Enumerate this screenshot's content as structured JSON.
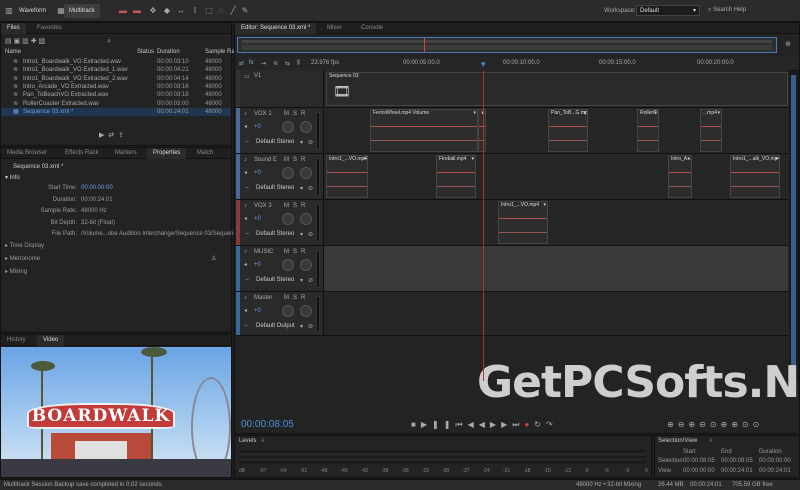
{
  "toolbar": {
    "waveform": "Waveform",
    "multitrack": "Multitrack",
    "workspace_label": "Workspace:",
    "workspace_value": "Default",
    "search_help": "Search Help"
  },
  "files": {
    "tabs": [
      "Files",
      "Favorites"
    ],
    "columns": [
      "Name",
      "Status",
      "Duration",
      "Sample Ra"
    ],
    "rows": [
      {
        "name": "Intro1_Boardwalk_VO Extracted.wav",
        "duration": "00:00:03:10",
        "rate": "48000"
      },
      {
        "name": "Intro1_Boardwalk_VO Extracted_1.wav",
        "duration": "00:00:04:21",
        "rate": "48000"
      },
      {
        "name": "Intro1_Boardwalk_VO Extracted_2.wav",
        "duration": "00:00:04:14",
        "rate": "48000"
      },
      {
        "name": "Intro_Arcade_VO Extracted.wav",
        "duration": "00:00:03:16",
        "rate": "48000"
      },
      {
        "name": "Pan_ToBeachVO Extracted.wav",
        "duration": "00:00:03:18",
        "rate": "48000"
      },
      {
        "name": "RollerCoaster Extracted.wav",
        "duration": "00:00:03:00",
        "rate": "48000"
      },
      {
        "name": "Sequence 03.xml *",
        "duration": "00:00:24:01",
        "rate": "48000"
      }
    ]
  },
  "props": {
    "tabs": [
      "Media Browser",
      "Effects Rack",
      "Markers",
      "Properties",
      "Match"
    ],
    "title": "Sequence 03.xml *",
    "info": "Info",
    "fields": [
      {
        "k": "Start Time:",
        "v": "00:00:00:00"
      },
      {
        "k": "Duration:",
        "v": "00:00:24:01"
      },
      {
        "k": "Sample Rate:",
        "v": "48000 Hz"
      },
      {
        "k": "Bit Depth:",
        "v": "32-bit (Float)"
      },
      {
        "k": "File Path:",
        "v": "/Volume...obe Audition Interchange/Sequence 03/Sequence 03.xml"
      }
    ],
    "sections": [
      "Time Display",
      "Metronome",
      "Mixing"
    ]
  },
  "video": {
    "tabs": [
      "History",
      "Video"
    ],
    "sign": "BOARDWALK"
  },
  "editor": {
    "tabs": [
      "Editor: Sequence 03.xml *",
      "Mixer",
      "Console"
    ],
    "fps": "23.976 fps",
    "ticks": [
      "00:00:05:00.0",
      "00:00:10:00.0",
      "00:00:15:00.0",
      "00:00:20:00.0"
    ],
    "time": "00:00:08:05",
    "watermark": "GetPCSofts.NET"
  },
  "tracks": [
    {
      "name": "V1",
      "clip": "Sequence 03"
    },
    {
      "name": "VOX 1",
      "vol": "+0",
      "out": "Default Stereo",
      "clips": [
        "FerrisWheel.mp4 Volume",
        "...pi",
        "Pan_ToB...G.mp4",
        "RollerC...",
        "...mp4"
      ]
    },
    {
      "name": "Sound E",
      "vol": "+0",
      "out": "Default Stereo",
      "clips": [
        "Intro1_...VO.mp4",
        "Fireball.mp4",
        "Intro_A...",
        "Intro1_...alk_VO.mp4"
      ]
    },
    {
      "name": "VOX 3",
      "vol": "+0",
      "out": "Default Stereo",
      "clips": [
        "Intro1_...VO.mp4"
      ]
    },
    {
      "name": "MUSIC",
      "vol": "+0",
      "out": "Default Stereo"
    },
    {
      "name": "Master",
      "vol": "+0",
      "out": "Default Output"
    }
  ],
  "levels": {
    "label": "Levels",
    "ticks": [
      "dB",
      "-57",
      "-54",
      "-51",
      "-48",
      "-45",
      "-42",
      "-39",
      "-36",
      "-33",
      "-30",
      "-27",
      "-24",
      "-21",
      "-18",
      "-15",
      "-12",
      "-9",
      "-6",
      "-3",
      "0"
    ]
  },
  "selection": {
    "label": "Selection/View",
    "cols": [
      "Start",
      "End",
      "Duration"
    ],
    "rows": [
      {
        "k": "Selection",
        "v": [
          "00:00:08:05",
          "00:00:08:05",
          "00:00:00:00"
        ]
      },
      {
        "k": "View",
        "v": [
          "00:00:00:00",
          "00:00:24:01",
          "00:00:24:01"
        ]
      }
    ]
  },
  "status": {
    "left": "Multitrack Session Backup save completed in 0.02 seconds",
    "rate": "48000 Hz • 32-bit Mixing",
    "size": "26.44 MB",
    "dur": "00:00:24:01",
    "free": "705.59 GB free"
  },
  "colors": {
    "accent": "#4a90d9",
    "playhead": "#e04040"
  }
}
